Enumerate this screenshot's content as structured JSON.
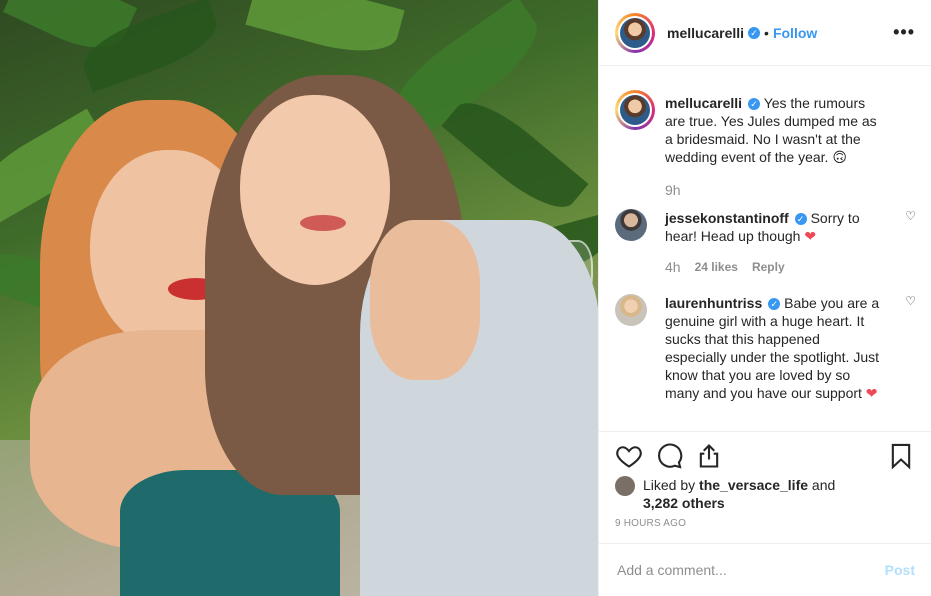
{
  "post": {
    "username": "mellucarelli",
    "follow_label": "Follow",
    "dot": "•",
    "more": "•••",
    "caption": {
      "username": "mellucarelli",
      "text": "Yes the rumours are true. Yes Jules dumped me as a bridesmaid. No I wasn't at the wedding event of the year. 🙃",
      "time": "9h"
    },
    "comments": [
      {
        "username": "jessekonstantinoff",
        "text": "Sorry to hear! Head up though",
        "emoji": "❤",
        "time": "4h",
        "likes": "24 likes",
        "reply": "Reply"
      },
      {
        "username": "laurenhuntriss",
        "text": "Babe you are a genuine girl with a huge heart. It sucks that this happened especially under the spotlight. Just know that you are loved by so many and you have our support",
        "emoji": "❤"
      }
    ],
    "liked_by_prefix": "Liked by",
    "liked_by_user": "the_versace_life",
    "liked_by_and": "and",
    "liked_by_others": "3,282 others",
    "timestamp": "9 HOURS AGO",
    "comment_placeholder": "Add a comment...",
    "post_button": "Post",
    "icons": {
      "like": "heart-icon",
      "comment": "comment-icon",
      "share": "share-icon",
      "save": "bookmark-icon",
      "verified": "verified-badge-icon"
    },
    "colors": {
      "link_blue": "#3897f0",
      "post_disabled": "#b2dffc",
      "heart_red": "#ed4956",
      "muted": "#8e8e8e"
    }
  }
}
